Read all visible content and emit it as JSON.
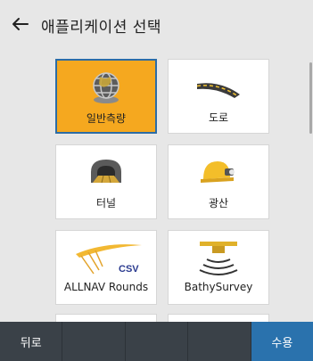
{
  "header": {
    "title": "애플리케이션 선택",
    "back_icon": "arrow-left-icon"
  },
  "tiles": [
    {
      "label": "일반측량",
      "icon": "globe-survey-icon",
      "selected": true
    },
    {
      "label": "도로",
      "icon": "road-icon",
      "selected": false
    },
    {
      "label": "터널",
      "icon": "tunnel-icon",
      "selected": false
    },
    {
      "label": "광산",
      "icon": "mining-helmet-icon",
      "selected": false
    },
    {
      "label": "ALLNAV Rounds",
      "icon": "allnav-csv-icon",
      "selected": false
    },
    {
      "label": "BathySurvey",
      "icon": "bathy-sonar-icon",
      "selected": false
    }
  ],
  "footer": {
    "back_label": "뒤로",
    "accept_label": "수용"
  },
  "colors": {
    "selected_tile": "#f5a81f",
    "selected_border": "#2c6ca6",
    "accept_button": "#2a72ad",
    "footer_bg": "#3a4148",
    "background": "#e7e7e7"
  }
}
